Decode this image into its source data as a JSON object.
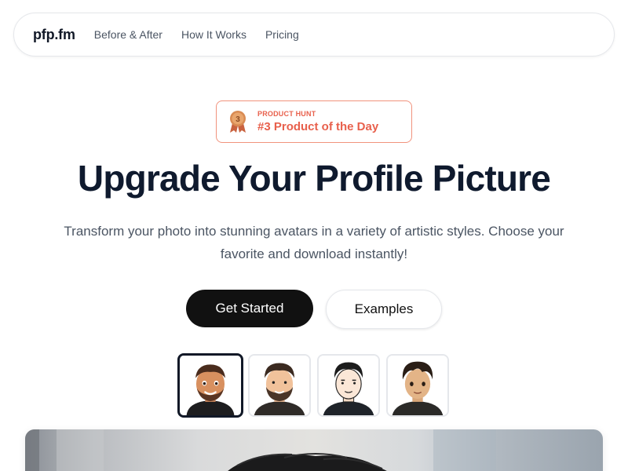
{
  "nav": {
    "logo": "pfp.fm",
    "links": [
      "Before & After",
      "How It Works",
      "Pricing"
    ]
  },
  "badge": {
    "medal_number": "3",
    "label": "PRODUCT HUNT",
    "title": "#3 Product of the Day",
    "color": "#e8604c"
  },
  "hero": {
    "title": "Upgrade Your Profile Picture",
    "subtitle": "Transform your photo into stunning avatars in a variety of artistic styles. Choose your favorite and download instantly!"
  },
  "buttons": {
    "primary": "Get Started",
    "secondary": "Examples"
  },
  "styles": {
    "selected_index": 0,
    "thumbnails": [
      "3d-cartoon-avatar",
      "illustrated-avatar",
      "line-art-avatar",
      "anime-avatar"
    ]
  }
}
